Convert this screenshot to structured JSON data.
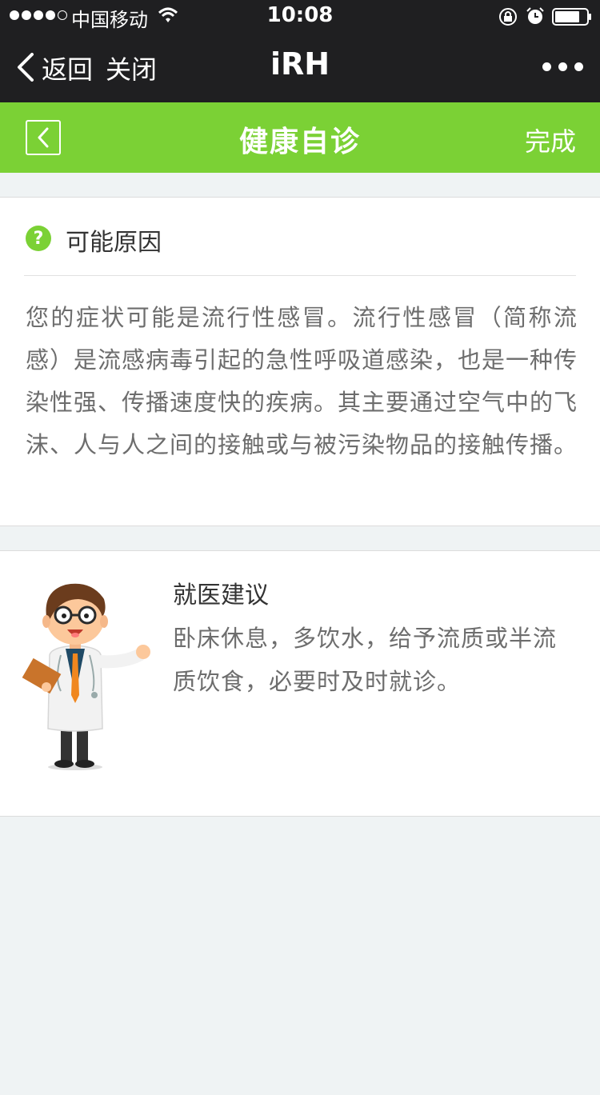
{
  "status_bar": {
    "carrier": "中国移动",
    "time": "10:08"
  },
  "wechat_nav": {
    "back_label": "返回",
    "close_label": "关闭",
    "title": "iRH"
  },
  "app_header": {
    "title": "健康自诊",
    "done_label": "完成",
    "accent_color": "#7bd135"
  },
  "possible_cause": {
    "icon": "question-circle-icon",
    "title": "可能原因",
    "text": "您的症状可能是流行性感冒。流行性感冒（简称流感）是流感病毒引起的急性呼吸道感染，也是一种传染性强、传播速度快的疾病。其主要通过空气中的飞沫、人与人之间的接触或与被污染物品的接触传播。"
  },
  "medical_advice": {
    "icon": "doctor-illustration",
    "title": "就医建议",
    "text": "卧床休息，多饮水，给予流质或半流质饮食，必要时及时就诊。"
  }
}
